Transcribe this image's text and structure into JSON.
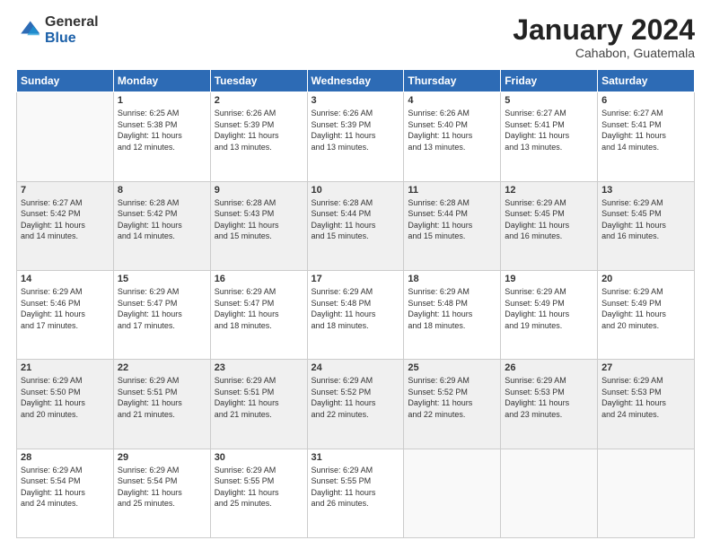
{
  "header": {
    "logo_general": "General",
    "logo_blue": "Blue",
    "month_title": "January 2024",
    "location": "Cahabon, Guatemala"
  },
  "weekdays": [
    "Sunday",
    "Monday",
    "Tuesday",
    "Wednesday",
    "Thursday",
    "Friday",
    "Saturday"
  ],
  "weeks": [
    [
      {
        "day": "",
        "sunrise": "",
        "sunset": "",
        "daylight": "",
        "empty": true
      },
      {
        "day": "1",
        "sunrise": "Sunrise: 6:25 AM",
        "sunset": "Sunset: 5:38 PM",
        "daylight": "Daylight: 11 hours and 12 minutes."
      },
      {
        "day": "2",
        "sunrise": "Sunrise: 6:26 AM",
        "sunset": "Sunset: 5:39 PM",
        "daylight": "Daylight: 11 hours and 13 minutes."
      },
      {
        "day": "3",
        "sunrise": "Sunrise: 6:26 AM",
        "sunset": "Sunset: 5:39 PM",
        "daylight": "Daylight: 11 hours and 13 minutes."
      },
      {
        "day": "4",
        "sunrise": "Sunrise: 6:26 AM",
        "sunset": "Sunset: 5:40 PM",
        "daylight": "Daylight: 11 hours and 13 minutes."
      },
      {
        "day": "5",
        "sunrise": "Sunrise: 6:27 AM",
        "sunset": "Sunset: 5:41 PM",
        "daylight": "Daylight: 11 hours and 13 minutes."
      },
      {
        "day": "6",
        "sunrise": "Sunrise: 6:27 AM",
        "sunset": "Sunset: 5:41 PM",
        "daylight": "Daylight: 11 hours and 14 minutes."
      }
    ],
    [
      {
        "day": "7",
        "sunrise": "Sunrise: 6:27 AM",
        "sunset": "Sunset: 5:42 PM",
        "daylight": "Daylight: 11 hours and 14 minutes."
      },
      {
        "day": "8",
        "sunrise": "Sunrise: 6:28 AM",
        "sunset": "Sunset: 5:42 PM",
        "daylight": "Daylight: 11 hours and 14 minutes."
      },
      {
        "day": "9",
        "sunrise": "Sunrise: 6:28 AM",
        "sunset": "Sunset: 5:43 PM",
        "daylight": "Daylight: 11 hours and 15 minutes."
      },
      {
        "day": "10",
        "sunrise": "Sunrise: 6:28 AM",
        "sunset": "Sunset: 5:44 PM",
        "daylight": "Daylight: 11 hours and 15 minutes."
      },
      {
        "day": "11",
        "sunrise": "Sunrise: 6:28 AM",
        "sunset": "Sunset: 5:44 PM",
        "daylight": "Daylight: 11 hours and 15 minutes."
      },
      {
        "day": "12",
        "sunrise": "Sunrise: 6:29 AM",
        "sunset": "Sunset: 5:45 PM",
        "daylight": "Daylight: 11 hours and 16 minutes."
      },
      {
        "day": "13",
        "sunrise": "Sunrise: 6:29 AM",
        "sunset": "Sunset: 5:45 PM",
        "daylight": "Daylight: 11 hours and 16 minutes."
      }
    ],
    [
      {
        "day": "14",
        "sunrise": "Sunrise: 6:29 AM",
        "sunset": "Sunset: 5:46 PM",
        "daylight": "Daylight: 11 hours and 17 minutes."
      },
      {
        "day": "15",
        "sunrise": "Sunrise: 6:29 AM",
        "sunset": "Sunset: 5:47 PM",
        "daylight": "Daylight: 11 hours and 17 minutes."
      },
      {
        "day": "16",
        "sunrise": "Sunrise: 6:29 AM",
        "sunset": "Sunset: 5:47 PM",
        "daylight": "Daylight: 11 hours and 18 minutes."
      },
      {
        "day": "17",
        "sunrise": "Sunrise: 6:29 AM",
        "sunset": "Sunset: 5:48 PM",
        "daylight": "Daylight: 11 hours and 18 minutes."
      },
      {
        "day": "18",
        "sunrise": "Sunrise: 6:29 AM",
        "sunset": "Sunset: 5:48 PM",
        "daylight": "Daylight: 11 hours and 18 minutes."
      },
      {
        "day": "19",
        "sunrise": "Sunrise: 6:29 AM",
        "sunset": "Sunset: 5:49 PM",
        "daylight": "Daylight: 11 hours and 19 minutes."
      },
      {
        "day": "20",
        "sunrise": "Sunrise: 6:29 AM",
        "sunset": "Sunset: 5:49 PM",
        "daylight": "Daylight: 11 hours and 20 minutes."
      }
    ],
    [
      {
        "day": "21",
        "sunrise": "Sunrise: 6:29 AM",
        "sunset": "Sunset: 5:50 PM",
        "daylight": "Daylight: 11 hours and 20 minutes."
      },
      {
        "day": "22",
        "sunrise": "Sunrise: 6:29 AM",
        "sunset": "Sunset: 5:51 PM",
        "daylight": "Daylight: 11 hours and 21 minutes."
      },
      {
        "day": "23",
        "sunrise": "Sunrise: 6:29 AM",
        "sunset": "Sunset: 5:51 PM",
        "daylight": "Daylight: 11 hours and 21 minutes."
      },
      {
        "day": "24",
        "sunrise": "Sunrise: 6:29 AM",
        "sunset": "Sunset: 5:52 PM",
        "daylight": "Daylight: 11 hours and 22 minutes."
      },
      {
        "day": "25",
        "sunrise": "Sunrise: 6:29 AM",
        "sunset": "Sunset: 5:52 PM",
        "daylight": "Daylight: 11 hours and 22 minutes."
      },
      {
        "day": "26",
        "sunrise": "Sunrise: 6:29 AM",
        "sunset": "Sunset: 5:53 PM",
        "daylight": "Daylight: 11 hours and 23 minutes."
      },
      {
        "day": "27",
        "sunrise": "Sunrise: 6:29 AM",
        "sunset": "Sunset: 5:53 PM",
        "daylight": "Daylight: 11 hours and 24 minutes."
      }
    ],
    [
      {
        "day": "28",
        "sunrise": "Sunrise: 6:29 AM",
        "sunset": "Sunset: 5:54 PM",
        "daylight": "Daylight: 11 hours and 24 minutes."
      },
      {
        "day": "29",
        "sunrise": "Sunrise: 6:29 AM",
        "sunset": "Sunset: 5:54 PM",
        "daylight": "Daylight: 11 hours and 25 minutes."
      },
      {
        "day": "30",
        "sunrise": "Sunrise: 6:29 AM",
        "sunset": "Sunset: 5:55 PM",
        "daylight": "Daylight: 11 hours and 25 minutes."
      },
      {
        "day": "31",
        "sunrise": "Sunrise: 6:29 AM",
        "sunset": "Sunset: 5:55 PM",
        "daylight": "Daylight: 11 hours and 26 minutes."
      },
      {
        "day": "",
        "sunrise": "",
        "sunset": "",
        "daylight": "",
        "empty": true
      },
      {
        "day": "",
        "sunrise": "",
        "sunset": "",
        "daylight": "",
        "empty": true
      },
      {
        "day": "",
        "sunrise": "",
        "sunset": "",
        "daylight": "",
        "empty": true
      }
    ]
  ]
}
